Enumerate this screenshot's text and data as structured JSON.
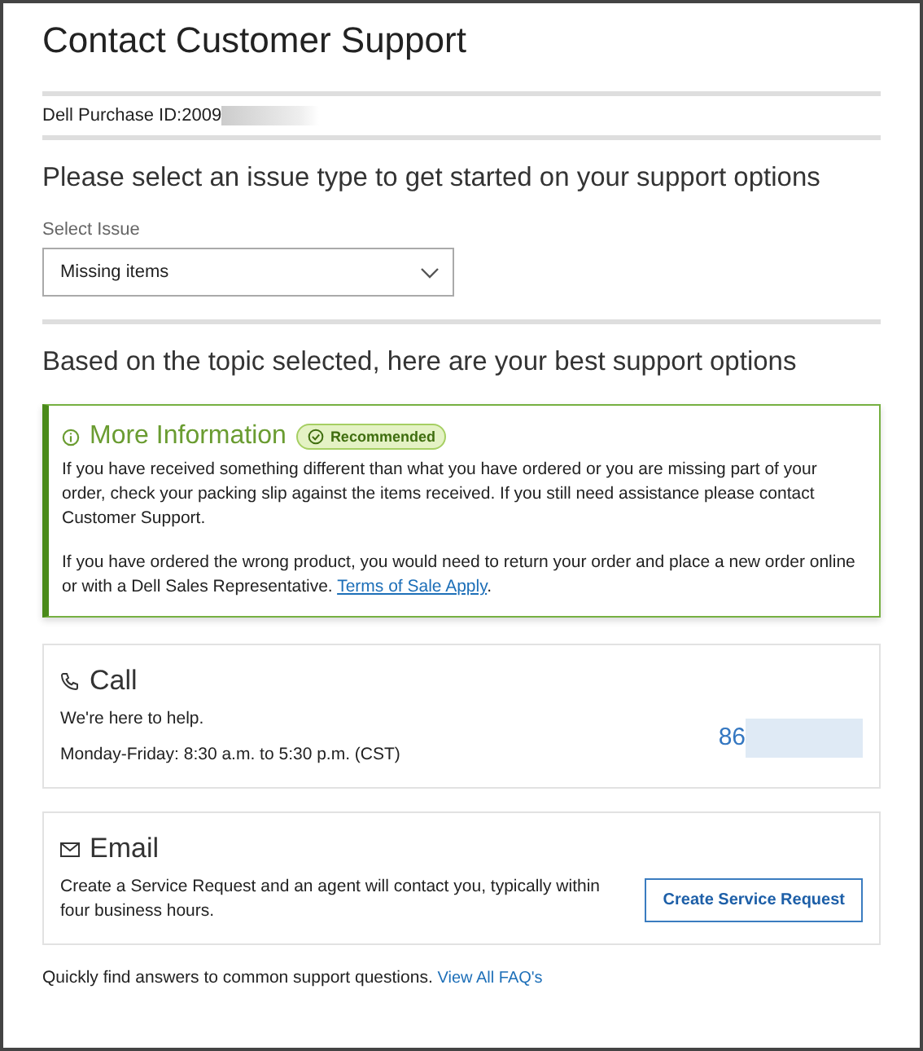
{
  "title": "Contact Customer Support",
  "purchase_id": "Dell Purchase ID:2009",
  "issue_heading": "Please select an issue type to get started on your support options",
  "select": {
    "label": "Select Issue",
    "value": "Missing items"
  },
  "options_heading": "Based on the topic selected, here are your best support options",
  "info": {
    "title": "More Information",
    "badge": "Recommended",
    "recommended": true,
    "paragraphs": [
      {
        "text": "If you have received something different than what you have ordered or you are missing part of your order, check your packing slip against the items received. If you still need assistance please contact Customer Support."
      },
      {
        "text": "If you have ordered the wrong product, you would need to return your order and place a new order online or with a Dell Sales Representative.",
        "link": "Terms of Sale Apply",
        "after": "."
      }
    ]
  },
  "call": {
    "title": "Call",
    "lines": [
      "We're here to help.",
      "Monday-Friday: 8:30 a.m. to 5:30 p.m. (CST)"
    ],
    "phone": "86"
  },
  "email": {
    "title": "Email",
    "text": "Create a Service Request and an agent will contact you, typically within four business hours.",
    "button": "Create Service Request"
  },
  "footer": {
    "text": "Quickly find answers to common support questions.",
    "link": "View All FAQ's"
  }
}
